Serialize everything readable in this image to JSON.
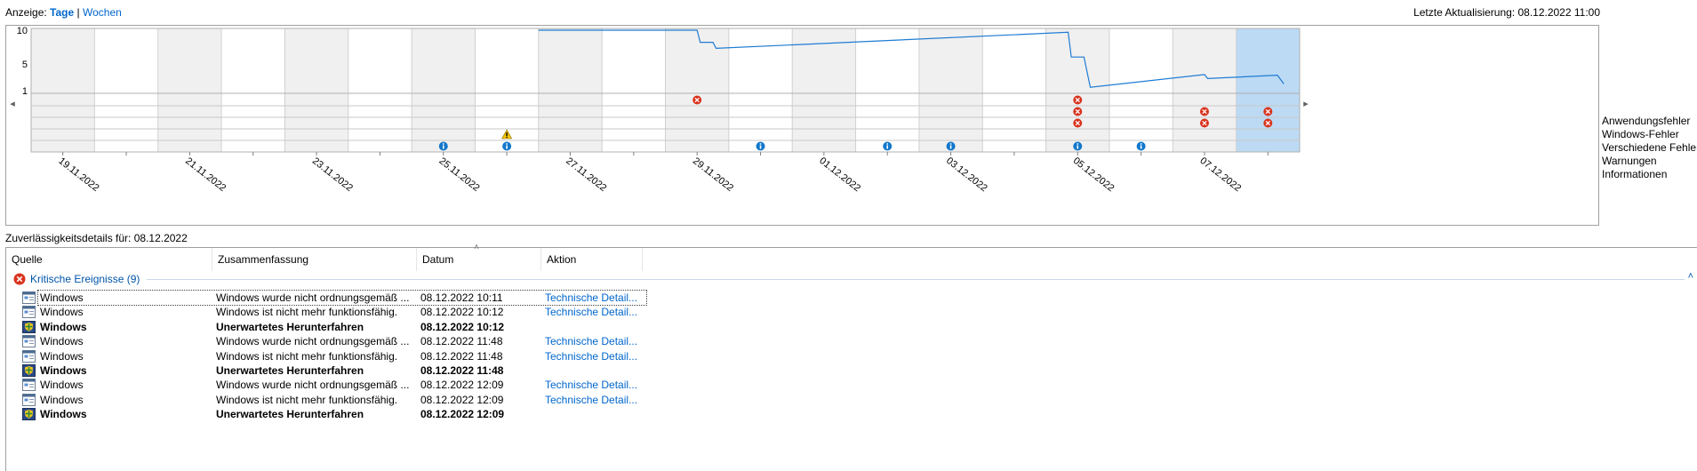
{
  "header": {
    "view_label": "Anzeige:",
    "days_label": "Tage",
    "separator": "|",
    "weeks_label": "Wochen",
    "last_update": "Letzte Aktualisierung: 08.12.2022 11:00"
  },
  "chart_data": {
    "type": "line",
    "y_ticks": [
      "10",
      "5",
      "1"
    ],
    "ylim": [
      1,
      10
    ],
    "nav_left": "◂",
    "nav_right": "▸",
    "date_labels": [
      "19.11.2022",
      "21.11.2022",
      "23.11.2022",
      "25.11.2022",
      "27.11.2022",
      "29.11.2022",
      "01.12.2022",
      "03.12.2022",
      "05.12.2022",
      "07.12.2022"
    ],
    "num_days": 20,
    "selected_day_index": 19,
    "stability_index": {
      "name": "",
      "points": [
        {
          "day": 8.0,
          "value": 10.0
        },
        {
          "day": 10.5,
          "value": 10.0
        },
        {
          "day": 10.55,
          "value": 8.2
        },
        {
          "day": 10.75,
          "value": 8.2
        },
        {
          "day": 10.8,
          "value": 7.3
        },
        {
          "day": 16.35,
          "value": 9.7
        },
        {
          "day": 16.4,
          "value": 6.0
        },
        {
          "day": 16.6,
          "value": 6.0
        },
        {
          "day": 16.7,
          "value": 1.5
        },
        {
          "day": 18.5,
          "value": 3.4
        },
        {
          "day": 18.55,
          "value": 2.8
        },
        {
          "day": 19.65,
          "value": 3.3
        },
        {
          "day": 19.75,
          "value": 2.0
        }
      ]
    },
    "event_rows": [
      "Anwendungsfehler",
      "Windows-Fehler",
      "Verschiedene Fehler",
      "Warnungen",
      "Informationen"
    ],
    "events": [
      {
        "row": 0,
        "day": 10.5,
        "kind": "error"
      },
      {
        "row": 0,
        "day": 16.5,
        "kind": "error"
      },
      {
        "row": 1,
        "day": 16.5,
        "kind": "error"
      },
      {
        "row": 1,
        "day": 18.5,
        "kind": "error"
      },
      {
        "row": 1,
        "day": 19.5,
        "kind": "error"
      },
      {
        "row": 2,
        "day": 16.5,
        "kind": "error"
      },
      {
        "row": 2,
        "day": 18.5,
        "kind": "error"
      },
      {
        "row": 2,
        "day": 19.5,
        "kind": "error"
      },
      {
        "row": 3,
        "day": 7.5,
        "kind": "warning"
      },
      {
        "row": 4,
        "day": 6.5,
        "kind": "info"
      },
      {
        "row": 4,
        "day": 7.5,
        "kind": "info"
      },
      {
        "row": 4,
        "day": 11.5,
        "kind": "info"
      },
      {
        "row": 4,
        "day": 13.5,
        "kind": "info"
      },
      {
        "row": 4,
        "day": 14.5,
        "kind": "info"
      },
      {
        "row": 4,
        "day": 16.5,
        "kind": "info"
      },
      {
        "row": 4,
        "day": 17.5,
        "kind": "info"
      }
    ],
    "colors": {
      "line": "#1e7bd4",
      "selected": "#bcdaf4",
      "shaded": "#f0f0f0",
      "error": "#d9341e",
      "warning": "#f5c400",
      "info": "#1177cc"
    }
  },
  "details": {
    "title": "Zuverlässigkeitsdetails für: 08.12.2022",
    "columns": {
      "source": "Quelle",
      "summary": "Zusammenfassung",
      "date": "Datum",
      "action": "Aktion"
    },
    "sort_caret": "˄",
    "group_label": "Kritische Ereignisse (9)",
    "group_collapse": "˄",
    "rows": [
      {
        "icon": "app-icon",
        "source": "Windows",
        "summary": "Windows wurde nicht ordnungsgemäß ...",
        "date": "08.12.2022 10:11",
        "action": "Technische Detail...",
        "bold": false,
        "selected": true
      },
      {
        "icon": "app-icon",
        "source": "Windows",
        "summary": "Windows ist nicht mehr funktionsfähig.",
        "date": "08.12.2022 10:12",
        "action": "Technische Detail...",
        "bold": false,
        "selected": false
      },
      {
        "icon": "shield-icon",
        "source": "Windows",
        "summary": "Unerwartetes Herunterfahren",
        "date": "08.12.2022 10:12",
        "action": "",
        "bold": true,
        "selected": false
      },
      {
        "icon": "app-icon",
        "source": "Windows",
        "summary": "Windows wurde nicht ordnungsgemäß ...",
        "date": "08.12.2022 11:48",
        "action": "Technische Detail...",
        "bold": false,
        "selected": false
      },
      {
        "icon": "app-icon",
        "source": "Windows",
        "summary": "Windows ist nicht mehr funktionsfähig.",
        "date": "08.12.2022 11:48",
        "action": "Technische Detail...",
        "bold": false,
        "selected": false
      },
      {
        "icon": "shield-icon",
        "source": "Windows",
        "summary": "Unerwartetes Herunterfahren",
        "date": "08.12.2022 11:48",
        "action": "",
        "bold": true,
        "selected": false
      },
      {
        "icon": "app-icon",
        "source": "Windows",
        "summary": "Windows wurde nicht ordnungsgemäß ...",
        "date": "08.12.2022 12:09",
        "action": "Technische Detail...",
        "bold": false,
        "selected": false
      },
      {
        "icon": "app-icon",
        "source": "Windows",
        "summary": "Windows ist nicht mehr funktionsfähig.",
        "date": "08.12.2022 12:09",
        "action": "Technische Detail...",
        "bold": false,
        "selected": false
      },
      {
        "icon": "shield-icon",
        "source": "Windows",
        "summary": "Unerwartetes Herunterfahren",
        "date": "08.12.2022 12:09",
        "action": "",
        "bold": true,
        "selected": false
      }
    ]
  }
}
